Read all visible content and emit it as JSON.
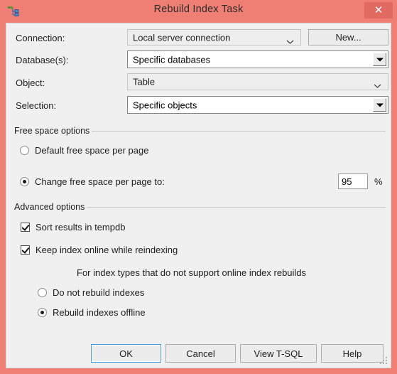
{
  "window": {
    "title": "Rebuild Index Task",
    "icon": "rebuild-index-task-icon",
    "close_label": "✕",
    "border_color": "#ef7f74",
    "client_bg": "#f0f0f0",
    "focus_color": "#3c9bdd"
  },
  "fields": [
    {
      "label": "Connection:",
      "value": "Local server connection",
      "style": "flat"
    },
    {
      "label": "Database(s):",
      "value": "Specific databases",
      "style": "3d"
    },
    {
      "label": "Object:",
      "value": "Table",
      "style": "flat"
    },
    {
      "label": "Selection:",
      "value": "Specific objects",
      "style": "3d"
    }
  ],
  "new_button": {
    "label": "New..."
  },
  "free_space": {
    "group_label": "Free space options",
    "option_default": {
      "label": "Default free space per page",
      "checked": false
    },
    "option_change": {
      "label": "Change free space per page to:",
      "checked": true
    },
    "percent_value": "95",
    "percent_sign": "%"
  },
  "advanced": {
    "group_label": "Advanced options",
    "sort_tempdb": {
      "label": "Sort results in tempdb",
      "checked": true
    },
    "keep_online": {
      "label": "Keep index online while reindexing",
      "checked": true
    },
    "note": "For index types that do not support online index rebuilds",
    "option_no_rebuild": {
      "label": "Do not rebuild indexes",
      "checked": false
    },
    "option_offline": {
      "label": "Rebuild indexes offline",
      "checked": true
    }
  },
  "buttons": {
    "ok": "OK",
    "cancel": "Cancel",
    "view_tsql": "View T-SQL",
    "help": "Help"
  }
}
